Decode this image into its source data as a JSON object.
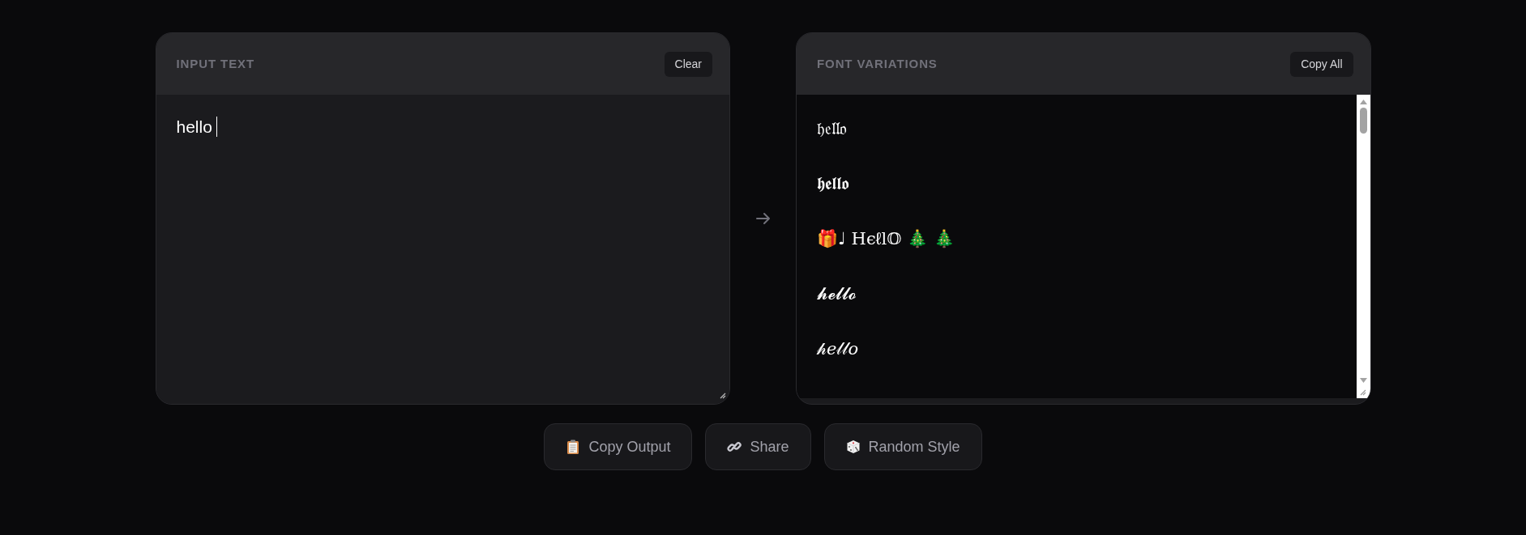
{
  "input_panel": {
    "title": "INPUT TEXT",
    "clear_button": "Clear",
    "text": "hello",
    "focused": true
  },
  "output_panel": {
    "title": "FONT VARIATIONS",
    "copy_all_button": "Copy All",
    "variations": [
      "𝔥𝔢𝔩𝔩𝔬",
      "𝖍𝖊𝖑𝖑𝖔",
      "🎁♩ Hєℓl𝕆  🎄 🎄",
      "𝓱𝓮𝓵𝓵𝓸",
      "𝒽𝑒𝓁𝓁𝑜"
    ]
  },
  "actions": [
    {
      "kind": "copy",
      "label": "Copy Output"
    },
    {
      "kind": "share",
      "label": "Share"
    },
    {
      "kind": "random",
      "label": "Random Style"
    }
  ]
}
